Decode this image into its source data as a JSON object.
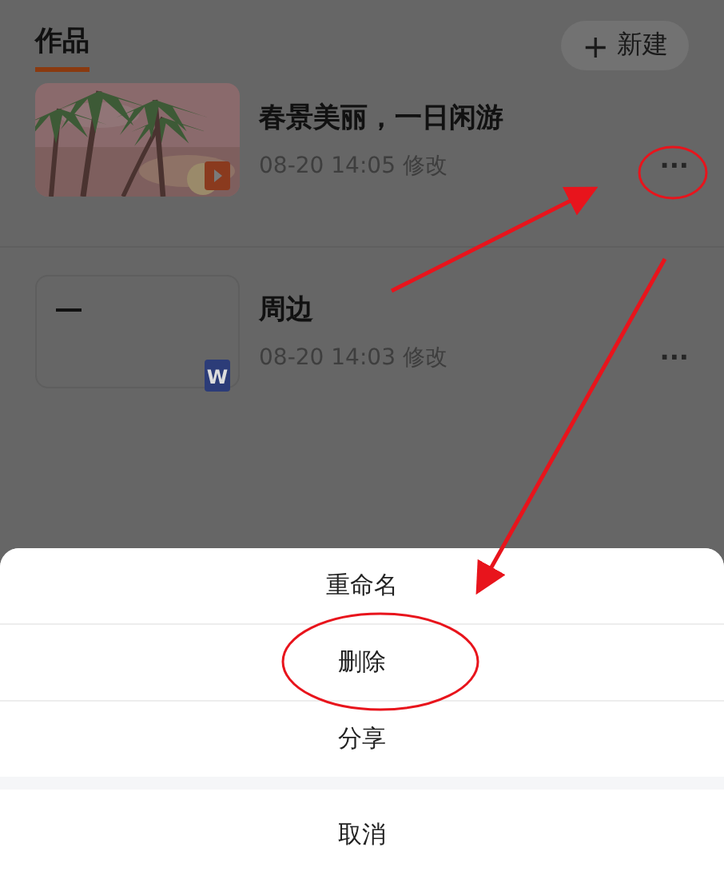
{
  "header": {
    "tabs": [
      {
        "label": "作品",
        "selected": true
      }
    ],
    "new_button": {
      "icon": "+",
      "label": "新建"
    }
  },
  "works": [
    {
      "title": "春景美丽，一日闲游",
      "meta": "08-20 14:05 修改",
      "more": "···",
      "thumbnail": {
        "kind": "picture",
        "badge": {
          "kind": "video"
        }
      }
    },
    {
      "title": "周边",
      "meta": "08-20 14:03 修改",
      "more": "···",
      "thumbnail": {
        "kind": "document",
        "badge": {
          "kind": "word",
          "text": "W"
        }
      }
    }
  ],
  "action_sheet": {
    "items": [
      "重命名",
      "删除",
      "分享"
    ],
    "cancel": "取消"
  }
}
